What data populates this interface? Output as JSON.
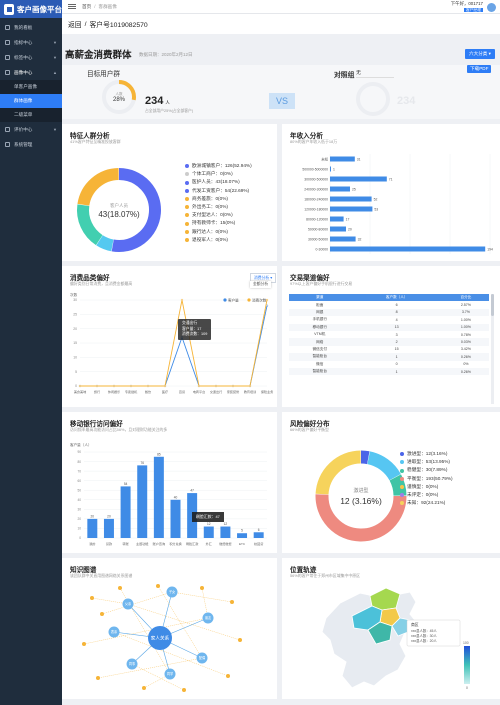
{
  "app": {
    "logo": "客户画像平台",
    "nav": [
      {
        "label": "我的看板",
        "arrow": false
      },
      {
        "label": "指标中心",
        "arrow": true
      },
      {
        "label": "标签中心",
        "arrow": true
      },
      {
        "label": "画像中心",
        "arrow": true
      }
    ],
    "subnav": [
      "单客户画像",
      "群体画像",
      "二级菜单"
    ],
    "nav2": [
      {
        "label": "评价中心",
        "arrow": true
      },
      {
        "label": "系统管理",
        "arrow": false
      }
    ]
  },
  "topbar": {
    "home": "首页",
    "sep": "/",
    "current": "客群画像",
    "user": "下午好，001717",
    "badge": "客户经理"
  },
  "crumb": {
    "back": "返回",
    "sep": "/",
    "title": "客户号1019082570"
  },
  "summary": {
    "title": "高薪金消费群体",
    "date": "数据日期：2020年2月12日",
    "select": "六大分类 ▾",
    "pdf": "下载PDF",
    "target_label": "目标用户群",
    "pct": "28%",
    "pct_sub": "人数",
    "count": "234",
    "count_unit": "人",
    "count_note": "占全部用户25%(占全部客户)",
    "vs": "VS",
    "compare_label": "对照组",
    "compare_value": "无",
    "compare_count": "234"
  },
  "features": {
    "title": "特征人群分析",
    "sub": "41%客户特征至精准投放客群",
    "center_label": "客户人员",
    "center_value": "43(18.07%)",
    "colors": [
      "#5a6cf2",
      "#54c9f0",
      "#42cfb0",
      "#f6b437"
    ],
    "items": [
      "欧洲城镇客户：126(52.94%)",
      "个体工商户：0(0%)",
      "医护人员：43(18.07%)",
      "代发工资客户：54(22.69%)",
      "商务差旅：0(0%)",
      "外出务工：0(0%)",
      "支付型达人：0(0%)",
      "持有教师卡：15(0%)",
      "跟行达人：0(0%)",
      "退役军人：0(0%)"
    ]
  },
  "income": {
    "title": "年收入分析",
    "sub": "80%的客户年收入低于18万",
    "chart_data": {
      "type": "bar",
      "categories": [
        "未知",
        "500000-5000000",
        "300000-500000",
        "240000-300000",
        "180000-240000",
        "120000-180000",
        "80000-120000",
        "50000-80000",
        "30000-50000",
        "0-30000"
      ],
      "values": [
        31,
        1,
        71,
        25,
        52,
        53,
        17,
        20,
        32,
        194
      ],
      "xlim": [
        0,
        200
      ]
    }
  },
  "consume": {
    "title": "消费品类偏好",
    "sub": "偏好类别日常消费，且消费金额最高",
    "select": "消费分析 ▾",
    "select2": "金额分析",
    "legend": [
      "客户量",
      "消费次数"
    ],
    "ylabel": "次数",
    "chart_data": {
      "type": "line",
      "categories": [
        "美食美味",
        "旅行",
        "休闲娱乐",
        "专卖健机",
        "餐饮",
        "医疗",
        "百货",
        "电商平台",
        "交通出行",
        "家装装修",
        "教育培训",
        "保险业务"
      ],
      "series": [
        {
          "name": "客户量",
          "values": [
            0,
            0,
            0,
            0,
            0,
            0,
            17,
            0,
            0,
            0,
            0,
            28
          ]
        },
        {
          "name": "消费次数",
          "values": [
            0,
            0,
            0,
            0,
            0,
            0,
            30,
            0,
            0,
            0,
            0,
            30
          ]
        }
      ],
      "ylim": [
        0,
        30
      ]
    },
    "tooltip": {
      "title": "交通出行",
      "line1": "客户量：17",
      "line2": "消费次数：109"
    }
  },
  "channel": {
    "title": "交易渠道偏好",
    "sub": "97%以上客户偏好手机银行进行交易",
    "headers": [
      "渠道",
      "客户数（人）",
      "百分比"
    ],
    "rows": [
      [
        "柜面",
        "6",
        "2.57%"
      ],
      [
        "网银",
        "8",
        "3.7%"
      ],
      [
        "手机银行",
        "4",
        "1.00%"
      ],
      [
        "移动银行",
        "13",
        "1.00%"
      ],
      [
        "VTM机",
        "3",
        "0.78%"
      ],
      [
        "网络",
        "2",
        "0.03%"
      ],
      [
        "微信支付",
        "15",
        "3.42%"
      ],
      [
        "智能柜台",
        "1",
        "0.26%"
      ],
      [
        "微信",
        "0",
        "0%"
      ],
      [
        "智能柜台",
        "1",
        "0.26%"
      ]
    ]
  },
  "bank": {
    "title": "移动银行访问偏好",
    "sub": "访问频率最高功能访问占比56%，且对理财功能关注的多",
    "ylabel": "客户量（人）",
    "chart_data": {
      "type": "bar",
      "categories": [
        "我的",
        "贷款",
        "转账",
        "主题功能",
        "账户查询",
        "积分兑换",
        "刷脸汇款",
        "外汇",
        "缴费缴费",
        "ETC",
        "校园贷"
      ],
      "values": [
        20,
        20,
        54,
        76,
        85,
        40,
        47,
        12,
        12,
        5,
        6
      ],
      "ylim": [
        0,
        90
      ]
    },
    "tooltip": "刷脸汇款：47"
  },
  "risk": {
    "title": "风险偏好分布",
    "sub": "66%的客户偏好平衡型",
    "center_label": "激进型",
    "center_value": "12 (3.16%)",
    "items": [
      "激进型：12(3.16%)",
      "进取型：53(13.95%)",
      "稳健型：30(7.89%)",
      "平衡型：193(50.79%)",
      "谨慎型：0(0%)",
      "未评定：0(0%)",
      "未知：92(24.21%)"
    ],
    "chart_data": {
      "type": "pie",
      "labels": [
        "激进型",
        "进取型",
        "稳健型",
        "平衡型",
        "谨慎型",
        "未评定",
        "未知"
      ],
      "values": [
        12,
        53,
        30,
        193,
        0,
        0,
        92
      ]
    },
    "colors": [
      "#4b64e8",
      "#56c6f2",
      "#40c4a5",
      "#ee8a80",
      "#f7c548",
      "#a17de8",
      "#f6d35c"
    ]
  },
  "knowledge": {
    "title": "知识图谱",
    "sub": "该团队群中关直用图谱网络关系图谱",
    "center": "家人关系",
    "nodes": [
      "父亲",
      "子女",
      "朋友",
      "配偶",
      "同学",
      "同事",
      "表亲"
    ]
  },
  "location": {
    "title": "位置轨迹",
    "sub": "56%的客户常住于郑州市区域集中中原区",
    "legend_title": "商区",
    "legend": [
      "xxx县人数：45人",
      "xxx县人数：30人",
      "xxx县人数：20人"
    ],
    "max": "100",
    "min": "0"
  }
}
